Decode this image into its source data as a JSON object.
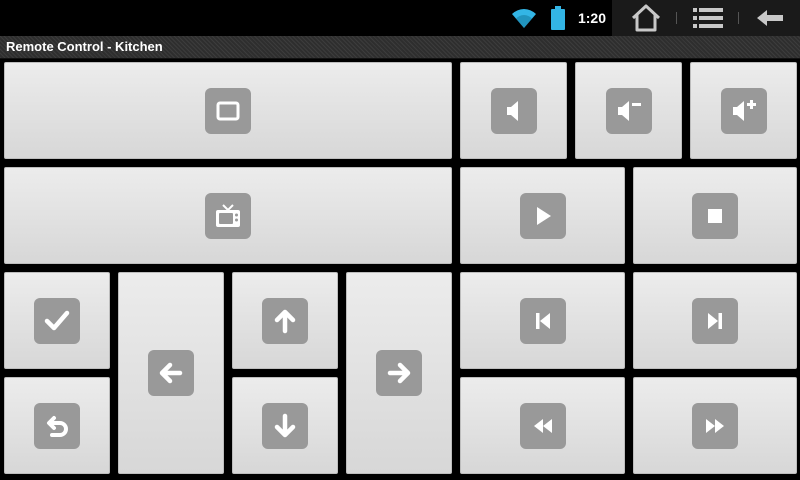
{
  "status_bar": {
    "time": "1:20",
    "icons": [
      "wifi-icon",
      "battery-icon",
      "home-icon",
      "menu-icon",
      "back-icon"
    ],
    "accent_color": "#33b5e5"
  },
  "window": {
    "title": "Remote Control - Kitchen"
  },
  "buttons": [
    "window-icon",
    "volume-mute-icon",
    "volume-down-icon",
    "volume-up-icon",
    "tv-icon",
    "play-icon",
    "stop-icon",
    "check-icon",
    "arrow-left-icon",
    "arrow-up-icon",
    "arrow-right-icon",
    "skip-previous-icon",
    "skip-next-icon",
    "undo-icon",
    "arrow-down-icon",
    "rewind-icon",
    "fast-forward-icon"
  ],
  "colors": {
    "button_bg": "#e2e2e2",
    "icon_bg": "#999999",
    "icon_fg": "#ffffff"
  }
}
